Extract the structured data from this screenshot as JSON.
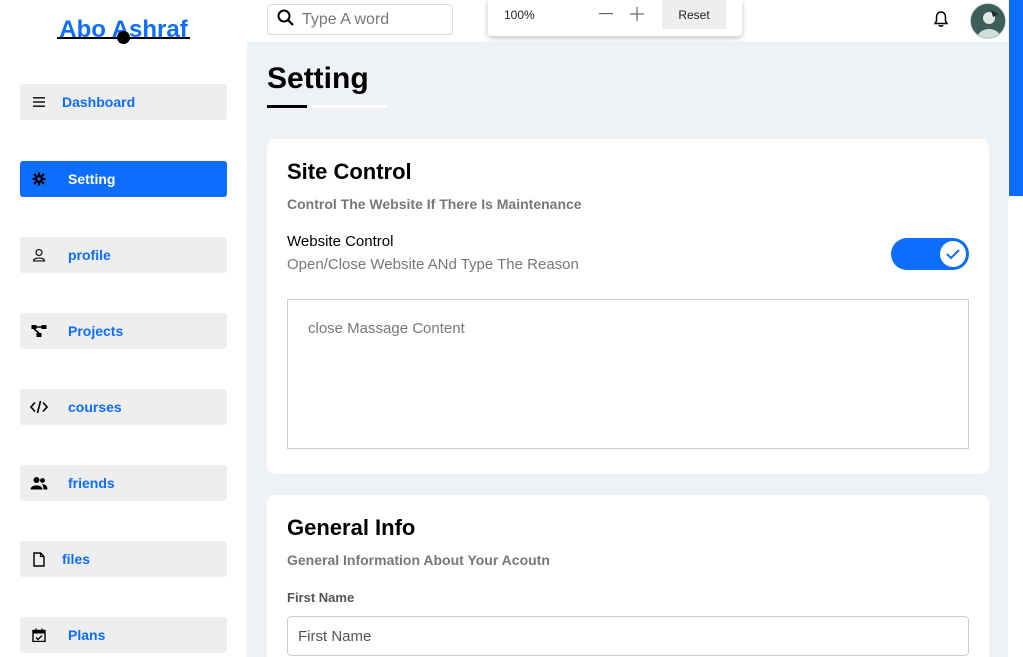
{
  "brand": {
    "title": "Abo Ashraf"
  },
  "sidebar": {
    "items": [
      {
        "label": "Dashboard",
        "icon": "bars-icon",
        "active": false
      },
      {
        "label": "Setting",
        "icon": "gear-icon",
        "active": true
      },
      {
        "label": "profile",
        "icon": "user-icon",
        "active": false
      },
      {
        "label": "Projects",
        "icon": "diagram-icon",
        "active": false
      },
      {
        "label": "courses",
        "icon": "code-icon",
        "active": false
      },
      {
        "label": "friends",
        "icon": "users-icon",
        "active": false
      },
      {
        "label": "files",
        "icon": "file-icon",
        "active": false
      },
      {
        "label": "Plans",
        "icon": "calendar-check-icon",
        "active": false
      }
    ]
  },
  "header": {
    "search_placeholder": "Type A word"
  },
  "zoom": {
    "level": "100%",
    "reset_label": "Reset"
  },
  "page": {
    "title": "Setting"
  },
  "site_control": {
    "title": "Site Control",
    "subtitle": "Control The Website If There Is Maintenance",
    "website_control_label": "Website Control",
    "website_control_sub": "Open/Close Website ANd Type The Reason",
    "toggle_on": true,
    "message_placeholder": "close Massage Content"
  },
  "general_info": {
    "title": "General Info",
    "subtitle": "General Information About Your Acoutn",
    "first_name_label": "First Name",
    "first_name_placeholder": "First Name"
  },
  "colors": {
    "accent": "#0d6efd",
    "background": "#eef1f6",
    "nav_bg": "#eeeeee"
  }
}
